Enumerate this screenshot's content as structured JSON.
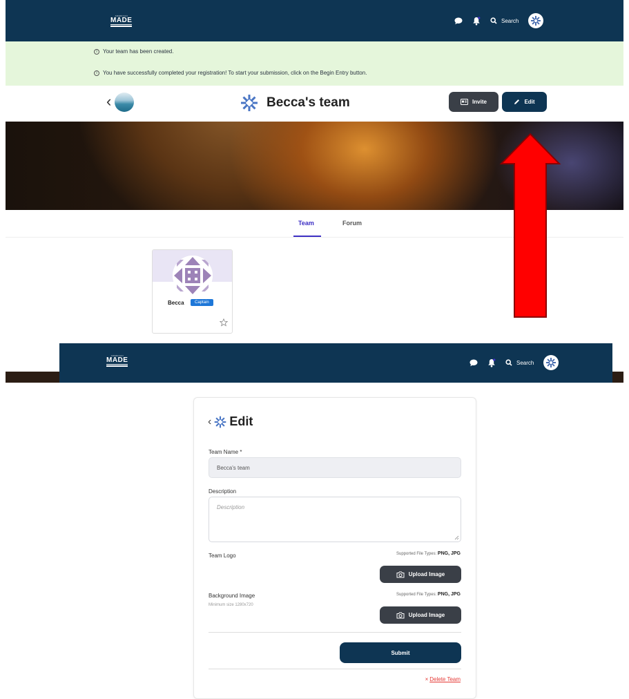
{
  "brand": {
    "logo_small": "AMERICAN",
    "logo_big": "MADE",
    "logo_sub": "CHALLENGE"
  },
  "nav": {
    "search_label": "Search"
  },
  "alerts": [
    "Your team has been created.",
    "You have successfully completed your registration! To start your submission, click on the Begin Entry button."
  ],
  "team": {
    "name": "Becca's team",
    "invite_label": "Invite",
    "edit_label": "Edit"
  },
  "tabs": [
    {
      "label": "Team",
      "active": true
    },
    {
      "label": "Forum",
      "active": false
    }
  ],
  "member": {
    "name": "Becca",
    "role": "Captain"
  },
  "edit_form": {
    "title": "Edit",
    "team_name_label": "Team Name *",
    "team_name_value": "Becca's team",
    "description_label": "Description",
    "description_placeholder": "Description",
    "team_logo_label": "Team Logo",
    "supported_prefix": "Supported File Types:",
    "supported_types": "PNG, JPG",
    "upload_label": "Upload Image",
    "background_label": "Background Image",
    "background_hint": "Minimum size 1280x720",
    "submit_label": "Submit",
    "delete_label": "Delete Team"
  },
  "colors": {
    "navy": "#0e3553",
    "alert_bg": "#e5f6db",
    "tab_active": "#3d2fc4",
    "captain_badge": "#1e77d8",
    "danger": "#e53935",
    "arrow": "#ff0000"
  },
  "icons": [
    "chat-icon",
    "bell-icon",
    "search-icon",
    "snowflake-logo-icon",
    "info-icon",
    "chevron-left-icon",
    "id-card-icon",
    "pencil-icon",
    "star-icon",
    "camera-icon",
    "close-icon"
  ]
}
